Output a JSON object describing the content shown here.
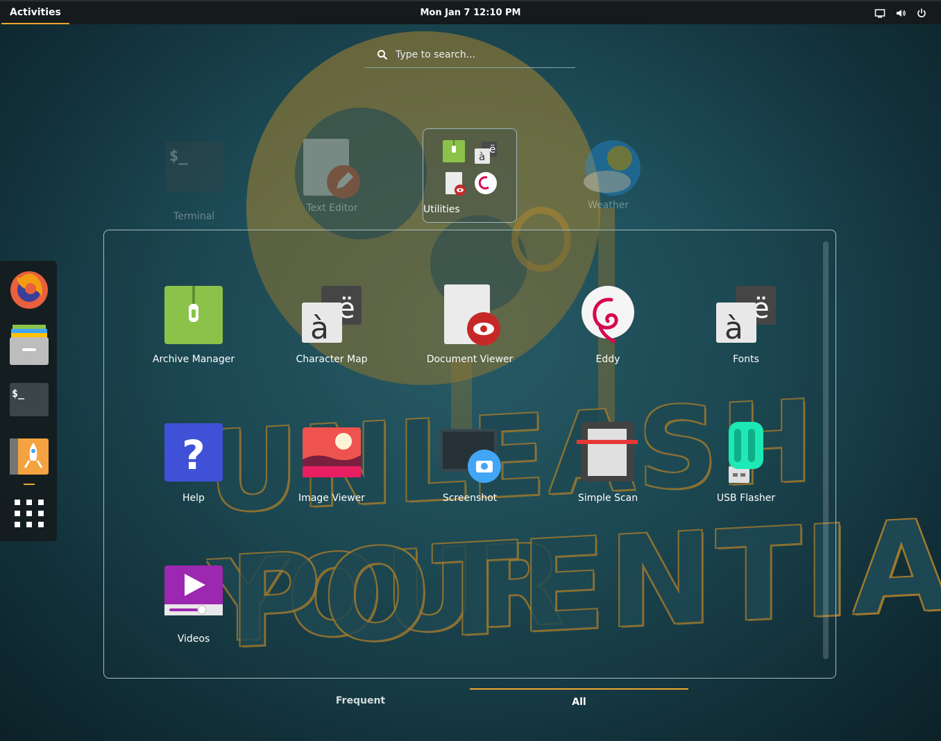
{
  "topbar": {
    "activities_label": "Activities",
    "clock": "Mon Jan 7  12:10 PM",
    "icons": [
      "screen-icon",
      "volume-icon",
      "power-icon"
    ]
  },
  "search": {
    "placeholder": "Type to search..."
  },
  "wallpaper": {
    "line1": "UNLEASH YOUR",
    "line2": "POTENTIAL"
  },
  "frequent": [
    {
      "label": "Terminal",
      "icon": "terminal-icon"
    },
    {
      "label": "Text Editor",
      "icon": "text-editor-icon"
    },
    {
      "label": "Utilities",
      "icon": "folder-icon"
    },
    {
      "label": "Weather",
      "icon": "weather-icon"
    }
  ],
  "apps": [
    {
      "label": "Archive Manager",
      "icon": "archive-icon"
    },
    {
      "label": "Character Map",
      "icon": "character-map-icon"
    },
    {
      "label": "Document Viewer",
      "icon": "document-viewer-icon"
    },
    {
      "label": "Eddy",
      "icon": "debian-swirl-icon"
    },
    {
      "label": "Fonts",
      "icon": "fonts-icon"
    },
    {
      "label": "Help",
      "icon": "help-icon"
    },
    {
      "label": "Image Viewer",
      "icon": "image-viewer-icon"
    },
    {
      "label": "Screenshot",
      "icon": "camera-icon"
    },
    {
      "label": "Simple Scan",
      "icon": "scanner-icon"
    },
    {
      "label": "USB Flasher",
      "icon": "usb-icon"
    },
    {
      "label": "Videos",
      "icon": "video-play-icon"
    }
  ],
  "dock": [
    "firefox-icon",
    "files-icon",
    "terminal-icon",
    "app-center-icon",
    "app-grid-icon"
  ],
  "tabs": {
    "frequent": "Frequent",
    "all": "All",
    "active": "All"
  },
  "colors": {
    "accent": "#f0a830",
    "topbar": "#151a1c"
  }
}
